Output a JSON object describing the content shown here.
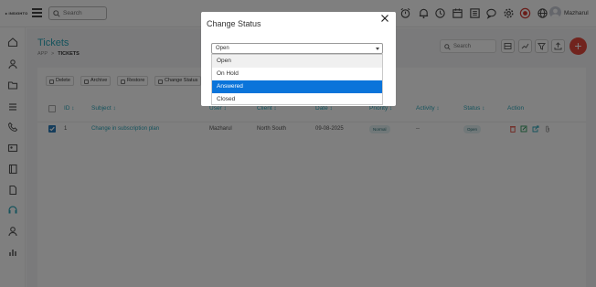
{
  "brand": {
    "logo": "▸ INSIGHTO"
  },
  "topbar": {
    "search_placeholder": "Search",
    "user_name": "Mazharul"
  },
  "page": {
    "title": "Tickets",
    "breadcrumb_root": "APP",
    "breadcrumb_sep": ">",
    "breadcrumb_current": "TICKETS",
    "search_placeholder": "Search",
    "add_label": "+"
  },
  "toolbar": {
    "delete": "Delete",
    "archive": "Archive",
    "restore": "Restore",
    "change_status": "Change Status"
  },
  "table": {
    "headers": {
      "id": "ID ↕",
      "subject": "Subject ↕",
      "user": "User ↕",
      "client": "Client ↕",
      "date": "Date ↕",
      "priority": "Priority ↕",
      "activity": "Activity ↕",
      "status": "Status ↕",
      "action": "Action"
    },
    "rows": [
      {
        "id": "1",
        "subject": "Change in subscription plan",
        "user": "Mazharul",
        "client": "North South",
        "date": "09-08-2025",
        "priority": "Normal",
        "activity": "--",
        "status": "Open"
      }
    ]
  },
  "modal": {
    "title": "Change Status",
    "close_label": "×",
    "select_value": "Open",
    "options": [
      "Open",
      "On Hold",
      "Answered",
      "Closed"
    ],
    "selected_option": "Answered"
  },
  "colors": {
    "accent": "#2aa6b9",
    "fab": "#e2483d",
    "option_selected": "#0a74da"
  }
}
